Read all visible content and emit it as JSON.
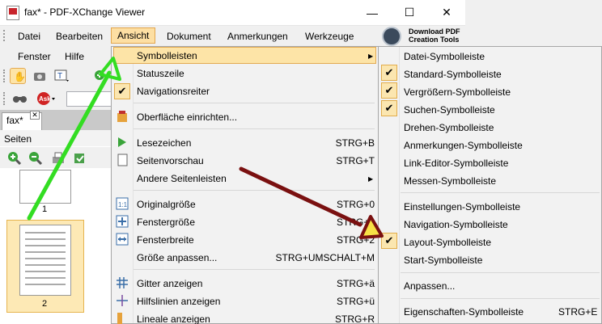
{
  "window": {
    "title": "fax* - PDF-XChange Viewer",
    "minimize": "—",
    "maximize": "☐",
    "close": "✕"
  },
  "menubar": {
    "items": [
      "Datei",
      "Bearbeiten",
      "Ansicht",
      "Dokument",
      "Anmerkungen",
      "Werkzeuge"
    ],
    "row2": [
      "Fenster",
      "Hilfe"
    ],
    "download_line1": "Download PDF",
    "download_line2": "Creation Tools"
  },
  "document": {
    "tab_label": "fax*",
    "tab_close": "✕",
    "pages_label": "Seiten",
    "thumb_numbers": [
      "1",
      "2"
    ]
  },
  "view_menu": {
    "items": [
      {
        "label": "Symbolleisten",
        "shortcut": "",
        "submenu": true
      },
      {
        "label": "Statuszeile",
        "shortcut": ""
      },
      {
        "label": "Navigationsreiter",
        "shortcut": "",
        "checked": true
      },
      {
        "label": "Oberfläche einrichten...",
        "shortcut": ""
      },
      {
        "label": "Lesezeichen",
        "shortcut": "STRG+B"
      },
      {
        "label": "Seitenvorschau",
        "shortcut": "STRG+T"
      },
      {
        "label": "Andere Seitenleisten",
        "shortcut": "",
        "submenu": true
      },
      {
        "label": "Originalgröße",
        "shortcut": "STRG+0"
      },
      {
        "label": "Fenstergröße",
        "shortcut": "STRG+1"
      },
      {
        "label": "Fensterbreite",
        "shortcut": "STRG+2"
      },
      {
        "label": "Größe anpassen...",
        "shortcut": "STRG+UMSCHALT+M"
      },
      {
        "label": "Gitter anzeigen",
        "shortcut": "STRG+ä"
      },
      {
        "label": "Hilfslinien anzeigen",
        "shortcut": "STRG+ü"
      },
      {
        "label": "Lineale anzeigen",
        "shortcut": "STRG+R"
      }
    ]
  },
  "toolbars_submenu": {
    "items": [
      {
        "label": "Datei-Symbolleiste",
        "checked": false
      },
      {
        "label": "Standard-Symbolleiste",
        "checked": true
      },
      {
        "label": "Vergrößern-Symbolleiste",
        "checked": true
      },
      {
        "label": "Suchen-Symbolleiste",
        "checked": true
      },
      {
        "label": "Drehen-Symbolleiste",
        "checked": false
      },
      {
        "label": "Anmerkungen-Symbolleiste",
        "checked": false
      },
      {
        "label": "Link-Editor-Symbolleiste",
        "checked": false
      },
      {
        "label": "Messen-Symbolleiste",
        "checked": false
      },
      {
        "label": "Einstellungen-Symbolleiste",
        "checked": false
      },
      {
        "label": "Navigation-Symbolleiste",
        "checked": false
      },
      {
        "label": "Layout-Symbolleiste",
        "checked": true
      },
      {
        "label": "Start-Symbolleiste",
        "checked": false
      },
      {
        "label": "Anpassen...",
        "checked": false
      },
      {
        "label": "Eigenschaften-Symbolleiste",
        "shortcut": "STRG+E",
        "checked": false
      }
    ]
  },
  "colors": {
    "highlight": "#fde4a7",
    "highlight_border": "#e3aa52",
    "annotation_green": "#33dd22",
    "annotation_maroon": "#7a1010",
    "annotation_triangle_fill": "#f7e046"
  }
}
